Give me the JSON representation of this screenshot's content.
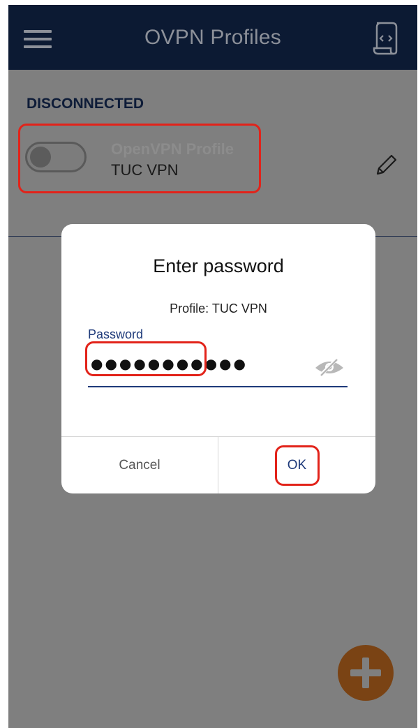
{
  "app_bar": {
    "title": "OVPN Profiles",
    "menu_icon": "hamburger-menu-icon",
    "import_icon": "import-file-icon"
  },
  "status": {
    "label": "DISCONNECTED"
  },
  "profile": {
    "type_label": "OpenVPN Profile",
    "name": "TUC VPN",
    "toggle_state": "off",
    "edit_icon": "pencil-icon"
  },
  "password_dialog": {
    "title": "Enter password",
    "subtitle": "Profile: TUC VPN",
    "field_label": "Password",
    "password_masked": "●●●●●●●●●●●",
    "visibility_icon": "eye-slash-icon",
    "cancel_label": "Cancel",
    "ok_label": "OK"
  },
  "fab": {
    "icon": "plus-icon"
  },
  "colors": {
    "app_bar": "#0c1a33",
    "overlay_background": "#7f7f7f",
    "accent_blue": "#1e3a7a",
    "fab": "#7a4314",
    "highlight": "#e2231a"
  }
}
